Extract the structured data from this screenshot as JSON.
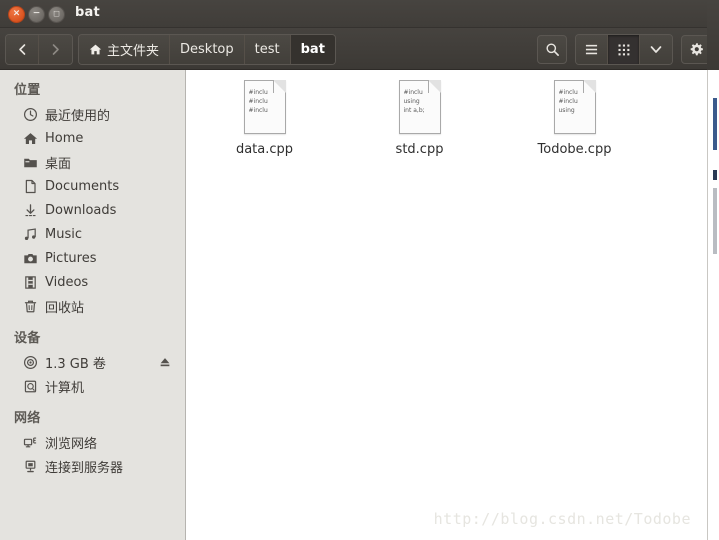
{
  "window": {
    "title": "bat",
    "controls": [
      {
        "name": "close",
        "glyph": "×"
      },
      {
        "name": "minimize",
        "glyph": "−"
      },
      {
        "name": "maximize",
        "glyph": "□"
      }
    ]
  },
  "toolbar": {
    "back_label": "‹",
    "forward_label": "›",
    "breadcrumbs": [
      {
        "label": "主文件夹",
        "icon": "home-icon",
        "active": false
      },
      {
        "label": "Desktop",
        "icon": "",
        "active": false
      },
      {
        "label": "test",
        "icon": "",
        "active": false
      },
      {
        "label": "bat",
        "icon": "",
        "active": true
      }
    ],
    "search_label": "search-icon",
    "list_view_label": "list-view-icon",
    "grid_view_label": "grid-view-icon",
    "dropdown_label": "chevron-down-icon",
    "settings_label": "gear-icon"
  },
  "sidebar": {
    "sections": [
      {
        "title": "位置",
        "items": [
          {
            "label": "最近使用的",
            "icon": "clock-icon",
            "eject": false
          },
          {
            "label": "Home",
            "icon": "home-icon",
            "eject": false
          },
          {
            "label": "桌面",
            "icon": "folder-icon",
            "eject": false
          },
          {
            "label": "Documents",
            "icon": "document-icon",
            "eject": false
          },
          {
            "label": "Downloads",
            "icon": "download-icon",
            "eject": false
          },
          {
            "label": "Music",
            "icon": "music-icon",
            "eject": false
          },
          {
            "label": "Pictures",
            "icon": "camera-icon",
            "eject": false
          },
          {
            "label": "Videos",
            "icon": "film-icon",
            "eject": false
          },
          {
            "label": "回收站",
            "icon": "trash-icon",
            "eject": false
          }
        ]
      },
      {
        "title": "设备",
        "items": [
          {
            "label": "1.3 GB 卷",
            "icon": "disc-icon",
            "eject": true
          },
          {
            "label": "计算机",
            "icon": "computer-icon",
            "eject": false
          }
        ]
      },
      {
        "title": "网络",
        "items": [
          {
            "label": "浏览网络",
            "icon": "network-icon",
            "eject": false
          },
          {
            "label": "连接到服务器",
            "icon": "server-icon",
            "eject": false
          }
        ]
      }
    ]
  },
  "content": {
    "files": [
      {
        "name": "data.cpp",
        "preview": [
          "#inclu",
          "#inclu",
          "#inclu"
        ]
      },
      {
        "name": "std.cpp",
        "preview": [
          "#inclu",
          "using ",
          "int a,b;"
        ]
      },
      {
        "name": "Todobe.cpp",
        "preview": [
          "#inclu",
          "#inclu",
          "using "
        ]
      }
    ],
    "watermark": "http://blog.csdn.net/Todobe"
  },
  "colors": {
    "titlebar": "#403d39",
    "toolbar": "#3c3935",
    "sidebar": "#e4e3df",
    "content": "#ffffff",
    "close_button": "#da5420",
    "active_crumb": "#35322e"
  }
}
